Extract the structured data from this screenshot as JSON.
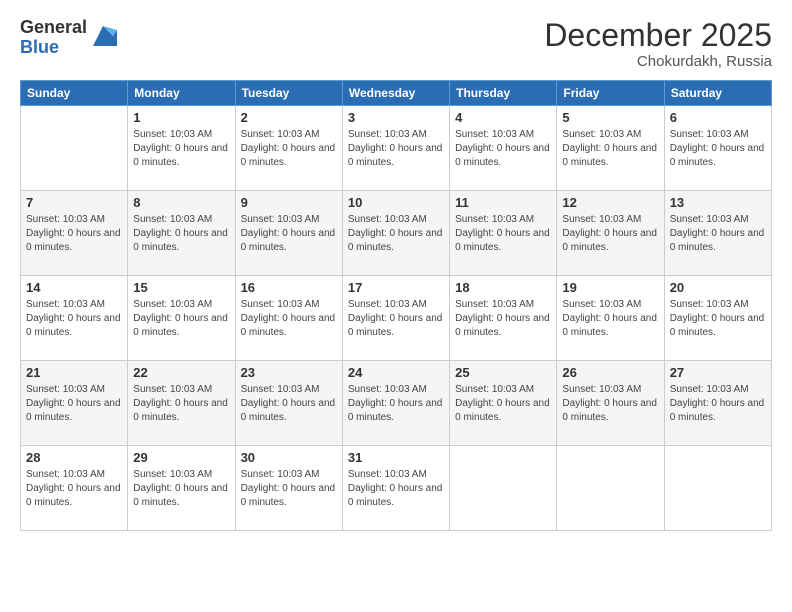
{
  "header": {
    "logo": {
      "general": "General",
      "blue": "Blue"
    },
    "title": "December 2025",
    "location": "Chokurdakh, Russia"
  },
  "weekdays": [
    "Sunday",
    "Monday",
    "Tuesday",
    "Wednesday",
    "Thursday",
    "Friday",
    "Saturday"
  ],
  "dayInfo": "Sunset: 10:03 AM\nDaylight: 0 hours and 0 minutes.",
  "weeks": [
    [
      {
        "day": "",
        "empty": true
      },
      {
        "day": "1"
      },
      {
        "day": "2"
      },
      {
        "day": "3"
      },
      {
        "day": "4"
      },
      {
        "day": "5"
      },
      {
        "day": "6"
      }
    ],
    [
      {
        "day": "7"
      },
      {
        "day": "8"
      },
      {
        "day": "9"
      },
      {
        "day": "10"
      },
      {
        "day": "11"
      },
      {
        "day": "12"
      },
      {
        "day": "13"
      }
    ],
    [
      {
        "day": "14"
      },
      {
        "day": "15"
      },
      {
        "day": "16"
      },
      {
        "day": "17"
      },
      {
        "day": "18"
      },
      {
        "day": "19"
      },
      {
        "day": "20"
      }
    ],
    [
      {
        "day": "21"
      },
      {
        "day": "22"
      },
      {
        "day": "23"
      },
      {
        "day": "24"
      },
      {
        "day": "25"
      },
      {
        "day": "26"
      },
      {
        "day": "27"
      }
    ],
    [
      {
        "day": "28"
      },
      {
        "day": "29"
      },
      {
        "day": "30"
      },
      {
        "day": "31"
      },
      {
        "day": "",
        "empty": true
      },
      {
        "day": "",
        "empty": true
      },
      {
        "day": "",
        "empty": true
      }
    ]
  ]
}
